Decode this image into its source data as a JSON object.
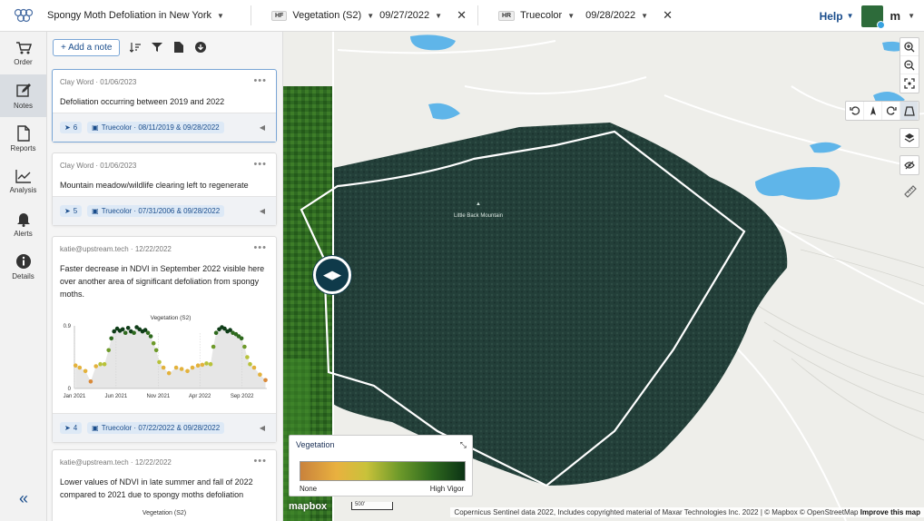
{
  "header": {
    "project_title": "Spongy Moth Defoliation in New York",
    "layer1": {
      "badge": "HF",
      "name": "Vegetation (S2)",
      "date": "09/27/2022"
    },
    "layer2": {
      "badge": "HR",
      "name": "Truecolor",
      "date": "09/28/2022"
    },
    "help_label": "Help",
    "user_initial": "m"
  },
  "nav": {
    "items": [
      {
        "label": "Order",
        "icon": "cart-icon"
      },
      {
        "label": "Notes",
        "icon": "pencil-icon",
        "active": true
      },
      {
        "label": "Reports",
        "icon": "document-icon"
      },
      {
        "label": "Analysis",
        "icon": "line-chart-icon"
      },
      {
        "label": "Alerts",
        "icon": "bell-icon"
      },
      {
        "label": "Details",
        "icon": "info-icon"
      }
    ]
  },
  "notes": {
    "add_note_label": "+ Add a note",
    "cards": [
      {
        "author": "Clay Word · 01/06/2023",
        "text": "Defoliation occurring between 2019 and 2022",
        "count": "6",
        "layer_pill": "Truecolor · 08/11/2019 & 09/28/2022"
      },
      {
        "author": "Clay Word · 01/06/2023",
        "text": "Mountain meadow/wildlife clearing left to regenerate",
        "count": "5",
        "layer_pill": "Truecolor · 07/31/2006 & 09/28/2022"
      },
      {
        "author": "katie@upstream.tech · 12/22/2022",
        "text": "Faster decrease in NDVI in September 2022 visible here over another area of significant defoliation from spongy moths.",
        "count": "4",
        "layer_pill": "Truecolor · 07/22/2022 & 09/28/2022"
      },
      {
        "author": "katie@upstream.tech · 12/22/2022",
        "text": "Lower values of NDVI in late summer and fall of 2022 compared to 2021 due to spongy moths defoliation",
        "chart_title_peek": "Vegetation (S2)"
      }
    ]
  },
  "chart_data": {
    "type": "scatter",
    "title": "Vegetation (S2)",
    "xlabel": "",
    "ylabel": "",
    "ylim": [
      0,
      0.9
    ],
    "y_ticks": [
      "0",
      "0.9"
    ],
    "x_ticks": [
      "Jan 2021",
      "Jun 2021",
      "Nov 2021",
      "Apr 2022",
      "Sep 2022"
    ],
    "x": [
      "2021-01-05",
      "2021-01-20",
      "2021-02-10",
      "2021-03-01",
      "2021-03-20",
      "2021-04-05",
      "2021-04-20",
      "2021-05-05",
      "2021-05-15",
      "2021-05-25",
      "2021-06-05",
      "2021-06-15",
      "2021-06-25",
      "2021-07-05",
      "2021-07-15",
      "2021-07-25",
      "2021-08-05",
      "2021-08-15",
      "2021-08-25",
      "2021-09-05",
      "2021-09-15",
      "2021-09-25",
      "2021-10-05",
      "2021-10-15",
      "2021-10-25",
      "2021-11-05",
      "2021-11-20",
      "2021-12-10",
      "2022-01-05",
      "2022-01-25",
      "2022-02-15",
      "2022-03-05",
      "2022-03-25",
      "2022-04-10",
      "2022-04-25",
      "2022-05-10",
      "2022-05-20",
      "2022-05-30",
      "2022-06-10",
      "2022-06-20",
      "2022-06-30",
      "2022-07-10",
      "2022-07-20",
      "2022-07-30",
      "2022-08-10",
      "2022-08-20",
      "2022-08-30",
      "2022-09-10",
      "2022-09-20",
      "2022-09-30",
      "2022-10-15",
      "2022-11-05",
      "2022-11-25"
    ],
    "y": [
      0.33,
      0.3,
      0.25,
      0.1,
      0.32,
      0.35,
      0.35,
      0.55,
      0.72,
      0.82,
      0.86,
      0.83,
      0.85,
      0.8,
      0.87,
      0.82,
      0.8,
      0.88,
      0.85,
      0.82,
      0.84,
      0.8,
      0.75,
      0.65,
      0.55,
      0.38,
      0.3,
      0.22,
      0.3,
      0.28,
      0.25,
      0.3,
      0.33,
      0.34,
      0.36,
      0.35,
      0.6,
      0.8,
      0.85,
      0.88,
      0.86,
      0.82,
      0.84,
      0.8,
      0.78,
      0.75,
      0.72,
      0.6,
      0.45,
      0.35,
      0.3,
      0.2,
      0.12
    ],
    "grid": false
  },
  "map": {
    "place_label": "Little Back Mountain",
    "legend_title": "Vegetation",
    "legend_low": "None",
    "legend_high": "High Vigor",
    "scale_label": "500'",
    "mapbox_logo": "mapbox",
    "attribution": "Copernicus Sentinel data 2022, Includes copyrighted material of Maxar Technologies Inc. 2022 | © Mapbox © OpenStreetMap",
    "improve_link": "Improve this map",
    "colors": {
      "forest": "#1f3b36",
      "water": "#5fb5e9",
      "boundary": "#ffffff",
      "accent": "#1a4d8c"
    }
  }
}
